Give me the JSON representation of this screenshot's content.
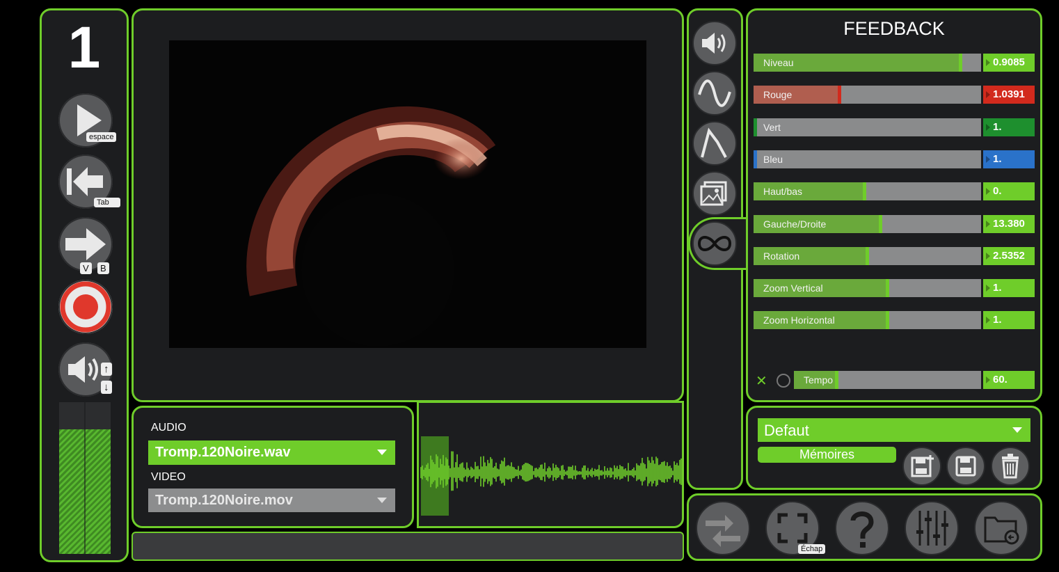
{
  "track": {
    "number": "1"
  },
  "transport": {
    "play_key": "espace",
    "rewind_key": "Tab",
    "next_keys": [
      "V",
      "B"
    ],
    "volume_keys": [
      "↑",
      "↓"
    ]
  },
  "level_meter": {
    "level": 0.82
  },
  "media": {
    "audio_label": "AUDIO",
    "audio_file": "Tromp.120Noire.wav",
    "video_label": "VIDEO",
    "video_file": "Tromp.120Noire.mov"
  },
  "feedback": {
    "title": "FEEDBACK",
    "params": [
      {
        "label": "Niveau",
        "value": "0.9085",
        "fraction": 0.91,
        "fill": "#6aa93b",
        "knob": "#6fcd2a",
        "box": "#6fcd2a"
      },
      {
        "label": "Rouge",
        "value": "1.0391",
        "fraction": 0.38,
        "fill": "#b05e4f",
        "knob": "#d22a1d",
        "box": "#d22a1d"
      },
      {
        "label": "Vert",
        "value": "1.",
        "fraction": 0.0,
        "fill": "#1e8f2e",
        "knob": "#1e8f2e",
        "box": "#1e8f2e"
      },
      {
        "label": "Bleu",
        "value": "1.",
        "fraction": 0.0,
        "fill": "#2a72c9",
        "knob": "#2a72c9",
        "box": "#2a72c9"
      },
      {
        "label": "Haut/bas",
        "value": "0.",
        "fraction": 0.49,
        "fill": "#6aa93b",
        "knob": "#6fcd2a",
        "box": "#6fcd2a"
      },
      {
        "label": "Gauche/Droite",
        "value": "13.380",
        "fraction": 0.56,
        "fill": "#6aa93b",
        "knob": "#6fcd2a",
        "box": "#6fcd2a"
      },
      {
        "label": "Rotation",
        "value": "2.5352",
        "fraction": 0.5,
        "fill": "#6aa93b",
        "knob": "#6fcd2a",
        "box": "#6fcd2a"
      },
      {
        "label": "Zoom Vertical",
        "value": "1.",
        "fraction": 0.59,
        "fill": "#6aa93b",
        "knob": "#6fcd2a",
        "box": "#6fcd2a"
      },
      {
        "label": "Zoom Horizontal",
        "value": "1.",
        "fraction": 0.59,
        "fill": "#6aa93b",
        "knob": "#6fcd2a",
        "box": "#6fcd2a"
      }
    ],
    "tempo": {
      "label": "Tempo",
      "value": "60.",
      "fraction": 0.23
    }
  },
  "presets": {
    "selected": "Defaut",
    "memories_label": "Mémoires"
  },
  "bottom": {
    "fullscreen_key": "Échap"
  },
  "colors": {
    "accent": "#6fcd2a",
    "panel": "#1c1d1f",
    "button": "#5d5e60"
  }
}
